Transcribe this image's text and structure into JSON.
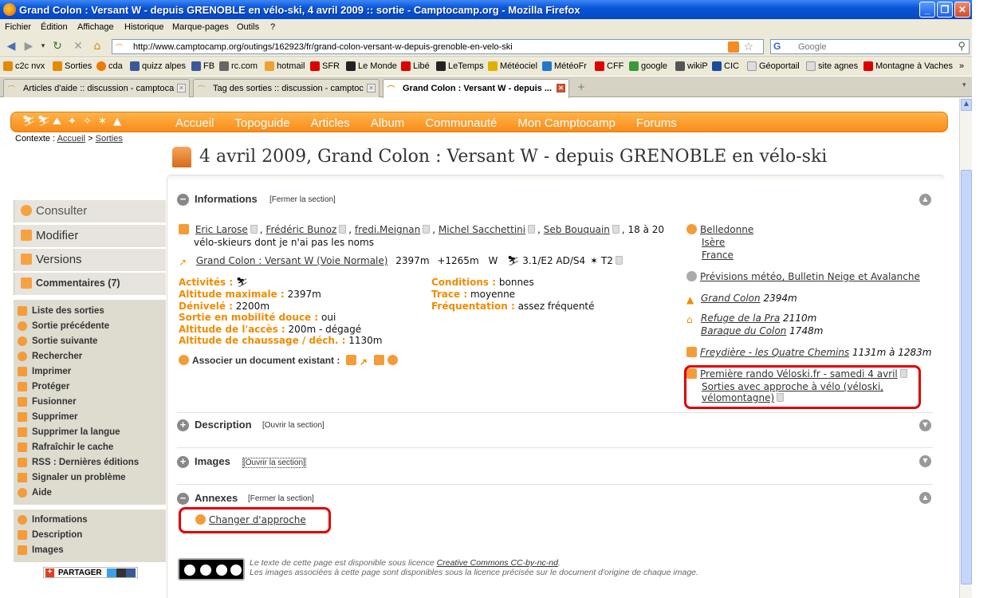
{
  "window": {
    "title": "Grand Colon : Versant W - depuis GRENOBLE en vélo-ski, 4 avril 2009 :: sortie - Camptocamp.org - Mozilla Firefox"
  },
  "menu": [
    "Fichier",
    "Édition",
    "Affichage",
    "Historique",
    "Marque-pages",
    "Outils",
    "?"
  ],
  "address_bar": {
    "url": "http://www.camptocamp.org/outings/162923/fr/grand-colon-versant-w-depuis-grenoble-en-velo-ski",
    "search_placeholder": "Google",
    "search_engine": "G"
  },
  "bookmarks": [
    "c2c nvx",
    "Sorties",
    "cda",
    "quizz alpes",
    "FB",
    "rc.com",
    "hotmail",
    "SFR",
    "Le Monde",
    "Libé",
    "LeTemps",
    "Météociel",
    "MétéoFr",
    "CFF",
    "google",
    "wikiP",
    "CIC",
    "Géoportail",
    "site agnes",
    "Montagne à Vaches",
    "»"
  ],
  "tabs": [
    {
      "label": "Articles d'aide :: discussion - camptoca..."
    },
    {
      "label": "Tag des sorties :: discussion - camptoc..."
    },
    {
      "label": "Grand Colon : Versant W - depuis ..."
    }
  ],
  "site_nav": [
    "Accueil",
    "Topoguide",
    "Articles",
    "Album",
    "Communauté",
    "Mon Camptocamp",
    "Forums"
  ],
  "context": {
    "label": "Contexte :",
    "home": "Accueil",
    "sep": ">",
    "section": "Sorties"
  },
  "page_title": "4 avril 2009, Grand Colon : Versant W - depuis GRENOBLE en vélo-ski",
  "sidebar": {
    "main": [
      "Consulter",
      "Modifier",
      "Versions",
      "Commentaires (7)"
    ],
    "actions": [
      "Liste des sorties",
      "Sortie précédente",
      "Sortie suivante",
      "Rechercher",
      "Imprimer",
      "Protéger",
      "Fusionner",
      "Supprimer",
      "Supprimer la langue",
      "Rafraîchir le cache",
      "RSS : Dernières éditions",
      "Signaler un problème",
      "Aide"
    ],
    "sections": [
      "Informations",
      "Description",
      "Images"
    ],
    "share": "PARTAGER"
  },
  "sections": {
    "informations": {
      "name": "Informations",
      "toggle": "[Fermer la section]"
    },
    "description": {
      "name": "Description",
      "toggle": "[Ouvrir la section]"
    },
    "images": {
      "name": "Images",
      "toggle": "[Ouvrir la section]"
    },
    "annexes": {
      "name": "Annexes",
      "toggle": "[Fermer la section]"
    }
  },
  "info": {
    "participants": [
      "Eric Larose",
      "Frédéric Bunoz",
      "fredi.Meignan",
      "Michel Sacchettini",
      "Seb Bouquain"
    ],
    "participants_rest": ", 18 à 20",
    "participants_line2": "vélo-skieurs dont je n'ai pas les noms",
    "route_link": "Grand Colon : Versant W (Voie Normale)",
    "route_alt": "2397m",
    "route_gain": "+1265m",
    "route_orient": "W",
    "route_rating": "3.1/E2 AD/S4",
    "route_t": "T2",
    "fields": [
      {
        "label": "Activités :",
        "value": ""
      },
      {
        "label": "Altitude maximale :",
        "value": "2397m"
      },
      {
        "label": "Dénivelé :",
        "value": "2200m"
      },
      {
        "label": "Sortie en mobilité douce :",
        "value": "oui"
      },
      {
        "label": "Altitude de l'accès :",
        "value": "200m - dégagé"
      },
      {
        "label": "Altitude de chaussage / déch. :",
        "value": "1130m"
      }
    ],
    "conditions": [
      {
        "label": "Conditions :",
        "value": "bonnes"
      },
      {
        "label": "Trace :",
        "value": "moyenne"
      },
      {
        "label": "Fréquentation :",
        "value": "assez fréquenté"
      }
    ],
    "associate": "Associer un document existant :"
  },
  "right_col": {
    "area": [
      "Belledonne",
      "Isère",
      "France"
    ],
    "weather": "Prévisions météo, Bulletin Neige et Avalanche",
    "summit": {
      "name": "Grand Colon",
      "alt": "2394m"
    },
    "huts": [
      {
        "name": "Refuge de la Pra",
        "alt": "2110m"
      },
      {
        "name": "Baraque du Colon",
        "alt": "1748m"
      }
    ],
    "parking": {
      "name": "Freydière - les Quatre Chemins",
      "alt": "1131m à 1283m"
    },
    "article_1": "Première rando Véloski.fr - samedi 4 avril",
    "article_2a": "Sorties avec approche à vélo (véloski,",
    "article_2b": "vélomontagne)"
  },
  "annexes": {
    "link": "Changer d'approche"
  },
  "licence": {
    "line1_pre": "Le texte de cette page est disponible sous licence",
    "line1_link": "Creative Commons CC-by-nc-nd",
    "line2": "Les images associées à cette page sont disponibles sous la licence précisée sur le document d'origine de chaque image."
  }
}
